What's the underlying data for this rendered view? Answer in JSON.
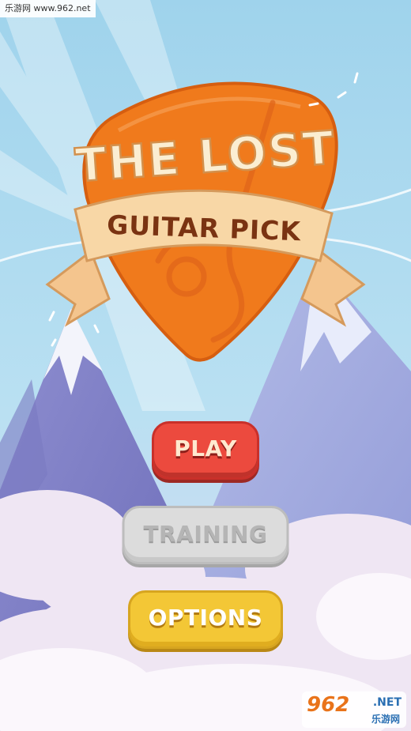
{
  "watermark": {
    "top_text": "乐游网 www.962.net"
  },
  "logo": {
    "line1": "THE LOST",
    "line2": "GUITAR PICK"
  },
  "menu": {
    "play_label": "PLAY",
    "training_label": "TRAINING",
    "options_label": "OPTIONS"
  },
  "corner_logo": {
    "number": "962",
    "suffix": ".NET",
    "cn": "乐游网"
  },
  "colors": {
    "sky": "#a9d8ee",
    "pick_orange": "#f07a1c",
    "play_red": "#ec4a3e",
    "training_gray": "#dcdcdc",
    "options_yellow": "#f3c736"
  }
}
